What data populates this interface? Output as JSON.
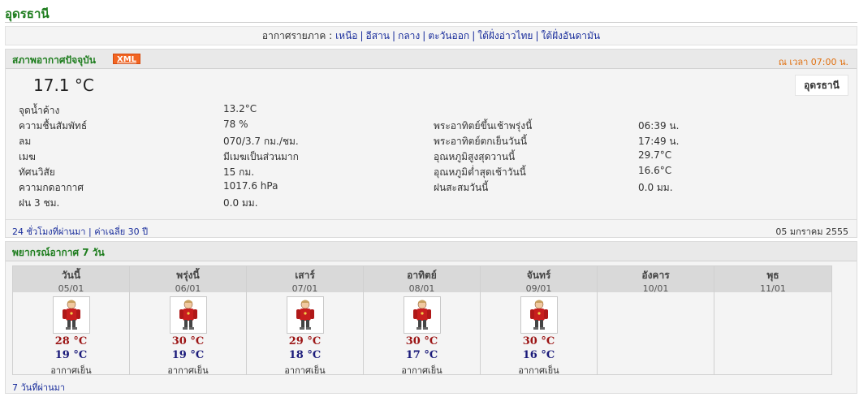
{
  "page": {
    "city_title": "อุดรธานี"
  },
  "region_nav": {
    "prefix": "อากาศรายภาค :",
    "links": [
      "เหนือ",
      "อีสาน",
      "กลาง",
      "ตะวันออก",
      "ใต้ฝั่งอ่าวไทย",
      "ใต้ฝั่งอันดามัน"
    ]
  },
  "current": {
    "title": "สภาพอากาศปัจจุบัน",
    "xml_badge": "XML",
    "time_note": "ณ เวลา 07:00 น.",
    "temperature": "17.1 °C",
    "station": "อุดรธานี",
    "left_rows": [
      {
        "label": "จุดน้ำค้าง",
        "value": "13.2°C"
      },
      {
        "label": "ความชื้นสัมพัทธ์",
        "value": "78 %"
      },
      {
        "label": "ลม",
        "value": "070/3.7 กม./ชม."
      },
      {
        "label": "เมฆ",
        "value": "มีเมฆเป็นส่วนมาก"
      },
      {
        "label": "ทัศนวิสัย",
        "value": "15 กม."
      },
      {
        "label": "ความกดอากาศ",
        "value": "1017.6 hPa"
      },
      {
        "label": "ฝน 3 ชม.",
        "value": "0.0 มม."
      }
    ],
    "right_rows": [
      {
        "label": "พระอาทิตย์ขึ้นเช้าพรุ่งนี้",
        "value": "06:39 น."
      },
      {
        "label": "พระอาทิตย์ตกเย็นวันนี้",
        "value": "17:49 น."
      },
      {
        "label": "อุณหภูมิสูงสุดวานนี้",
        "value": "29.7°C"
      },
      {
        "label": "อุณหภูมิต่ำสุดเช้าวันนี้",
        "value": "16.6°C"
      },
      {
        "label": "ฝนสะสมวันนี้",
        "value": "0.0 มม."
      }
    ],
    "footer": {
      "link_24h": "24 ชั่วโมงที่ผ่านมา",
      "link_avg": "ค่าเฉลี่ย 30 ปี",
      "date": "05 มกราคม 2555"
    }
  },
  "forecast": {
    "title": "พยากรณ์อากาศ 7 วัน",
    "days": [
      {
        "day": "วันนี้",
        "date": "05/01",
        "max": "28 °C",
        "min": "19 °C",
        "desc": "อากาศเย็น",
        "has_icon": true
      },
      {
        "day": "พรุ่งนี้",
        "date": "06/01",
        "max": "30 °C",
        "min": "19 °C",
        "desc": "อากาศเย็น",
        "has_icon": true
      },
      {
        "day": "เสาร์",
        "date": "07/01",
        "max": "29 °C",
        "min": "18 °C",
        "desc": "อากาศเย็น",
        "has_icon": true
      },
      {
        "day": "อาทิตย์",
        "date": "08/01",
        "max": "30 °C",
        "min": "17 °C",
        "desc": "อากาศเย็น",
        "has_icon": true
      },
      {
        "day": "จันทร์",
        "date": "09/01",
        "max": "30 °C",
        "min": "16 °C",
        "desc": "อากาศเย็น",
        "has_icon": true
      },
      {
        "day": "อังคาร",
        "date": "10/01",
        "max": "",
        "min": "",
        "desc": "",
        "has_icon": false
      },
      {
        "day": "พุธ",
        "date": "11/01",
        "max": "",
        "min": "",
        "desc": "",
        "has_icon": false
      }
    ],
    "past_link": "7 วันที่ผ่านมา"
  },
  "icons": {
    "weather_icon": "cold-person-icon"
  },
  "colors": {
    "title_green": "#1e7d1e",
    "link_blue": "#1a2e9c",
    "xml_orange": "#f26522",
    "max_red": "#9b1414",
    "min_blue": "#1a1a7a"
  }
}
